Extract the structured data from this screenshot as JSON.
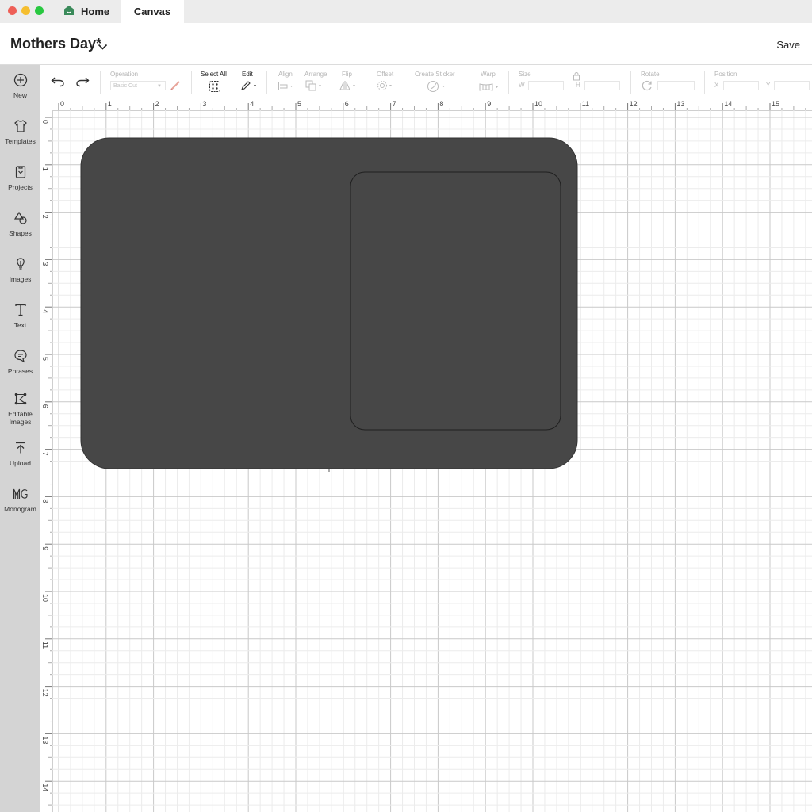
{
  "window": {
    "tabs": [
      {
        "label": "Home",
        "icon": "home-icon"
      },
      {
        "label": "Canvas"
      }
    ]
  },
  "header": {
    "title": "Mothers Day*",
    "save_label": "Save"
  },
  "sidebar": {
    "items": [
      {
        "label": "New",
        "icon": "plus-circle-icon"
      },
      {
        "label": "Templates",
        "icon": "shirt-icon"
      },
      {
        "label": "Projects",
        "icon": "projects-icon"
      },
      {
        "label": "Shapes",
        "icon": "shapes-icon"
      },
      {
        "label": "Images",
        "icon": "lightbulb-icon"
      },
      {
        "label": "Text",
        "icon": "text-icon"
      },
      {
        "label": "Phrases",
        "icon": "speech-bubble-icon"
      },
      {
        "label": "Editable",
        "label2": "Images",
        "icon": "editable-images-icon"
      },
      {
        "label": "Upload",
        "icon": "upload-icon"
      },
      {
        "label": "Monogram",
        "icon": "monogram-icon"
      }
    ]
  },
  "toolbar": {
    "operation_label": "Operation",
    "operation_value": "Basic Cut",
    "select_all_label": "Select All",
    "edit_label": "Edit",
    "align_label": "Align",
    "arrange_label": "Arrange",
    "flip_label": "Flip",
    "offset_label": "Offset",
    "create_sticker_label": "Create Sticker",
    "warp_label": "Warp",
    "size_label": "Size",
    "size_w": "W",
    "size_h": "H",
    "rotate_label": "Rotate",
    "position_label": "Position",
    "pos_x": "X",
    "pos_y": "Y"
  },
  "rulers": {
    "top": [
      "0",
      "1",
      "2",
      "3",
      "4",
      "5",
      "6",
      "7",
      "8",
      "9",
      "10",
      "11",
      "12",
      "13",
      "14",
      "15"
    ],
    "left": [
      "0",
      "1",
      "2",
      "3",
      "4",
      "5",
      "6",
      "7",
      "8",
      "9",
      "10",
      "11",
      "12",
      "13",
      "14"
    ]
  },
  "colors": {
    "shape_fill": "#474747",
    "sidebar_bg": "#d4d4d4",
    "accent_home": "#3a8a5a",
    "traffic_close": "#ee5f57",
    "traffic_min": "#f5be2f",
    "traffic_max": "#28c840"
  }
}
